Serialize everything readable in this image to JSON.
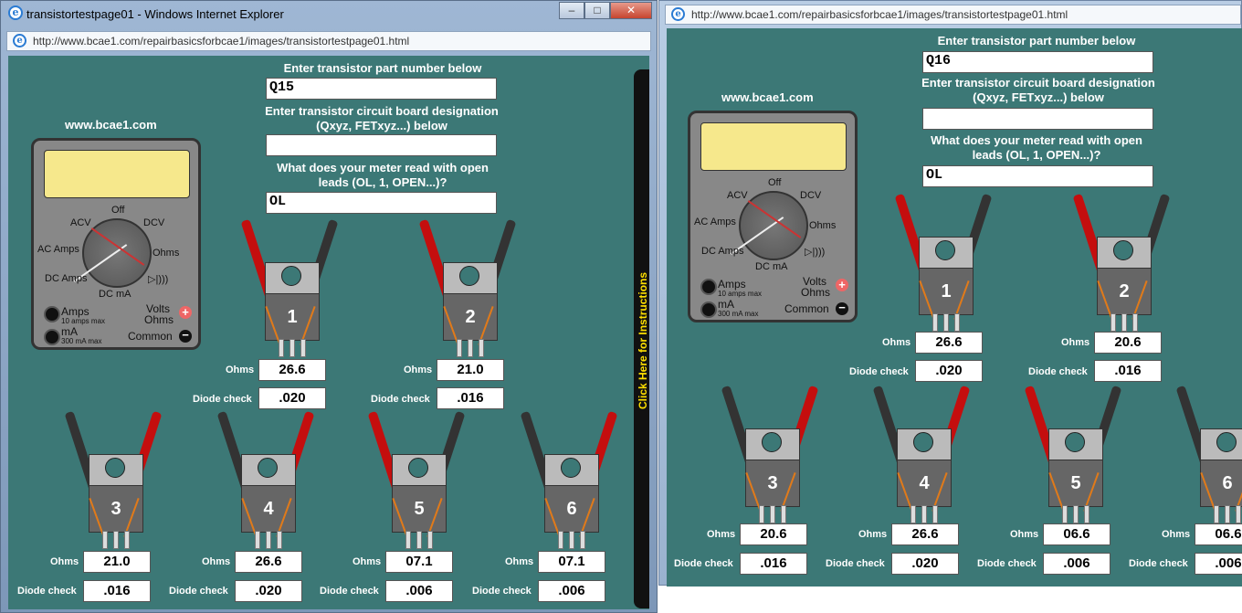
{
  "win1": {
    "title": "transistortestpage01 - Windows Internet Explorer",
    "url": "http://www.bcae1.com/repairbasicsforbcae1/images/transistortestpage01.html",
    "controls": [
      "–",
      "□",
      "✕"
    ],
    "site": "www.bcae1.com",
    "labels": {
      "part": "Enter transistor part number below",
      "designation": "Enter transistor circuit board designation (Qxyz, FETxyz...) below",
      "meter_q": "What does your meter read with open leads (OL, 1, OPEN...)?"
    },
    "fields": {
      "part": "Q15",
      "designation": "",
      "meter": "OL"
    },
    "instructions": "Click Here for Instructions",
    "transistors": [
      {
        "num": "1",
        "ohms": "26.6",
        "diode": ".020"
      },
      {
        "num": "2",
        "ohms": "21.0",
        "diode": ".016"
      },
      {
        "num": "3",
        "ohms": "21.0",
        "diode": ".016"
      },
      {
        "num": "4",
        "ohms": "26.6",
        "diode": ".020"
      },
      {
        "num": "5",
        "ohms": "07.1",
        "diode": ".006"
      },
      {
        "num": "6",
        "ohms": "07.1",
        "diode": ".006"
      }
    ]
  },
  "win2": {
    "url": "http://www.bcae1.com/repairbasicsforbcae1/images/transistortestpage01.html",
    "site": "www.bcae1.com",
    "fields": {
      "part": "Q16",
      "designation": "",
      "meter": "OL"
    },
    "transistors": [
      {
        "num": "1",
        "ohms": "26.6",
        "diode": ".020"
      },
      {
        "num": "2",
        "ohms": "20.6",
        "diode": ".016"
      },
      {
        "num": "3",
        "ohms": "20.6",
        "diode": ".016"
      },
      {
        "num": "4",
        "ohms": "26.6",
        "diode": ".020"
      },
      {
        "num": "5",
        "ohms": "06.6",
        "diode": ".006"
      },
      {
        "num": "6",
        "ohms": "06.6",
        "diode": ".006"
      }
    ]
  },
  "meter": {
    "off": "Off",
    "acv": "ACV",
    "dcv": "DCV",
    "ac_amps": "AC Amps",
    "ohms": "Ohms",
    "dc_amps": "DC Amps",
    "dc_ma": "DC mA",
    "diode": "▷|)))",
    "amps": "Amps",
    "amps_sub": "10 amps max",
    "ma": "mA",
    "ma_sub": "300 mA max",
    "volts": "Volts",
    "ohms2": "Ohms",
    "common": "Common",
    "plus": "+",
    "minus": "−"
  },
  "row_labels": {
    "ohms": "Ohms",
    "diode": "Diode check"
  }
}
